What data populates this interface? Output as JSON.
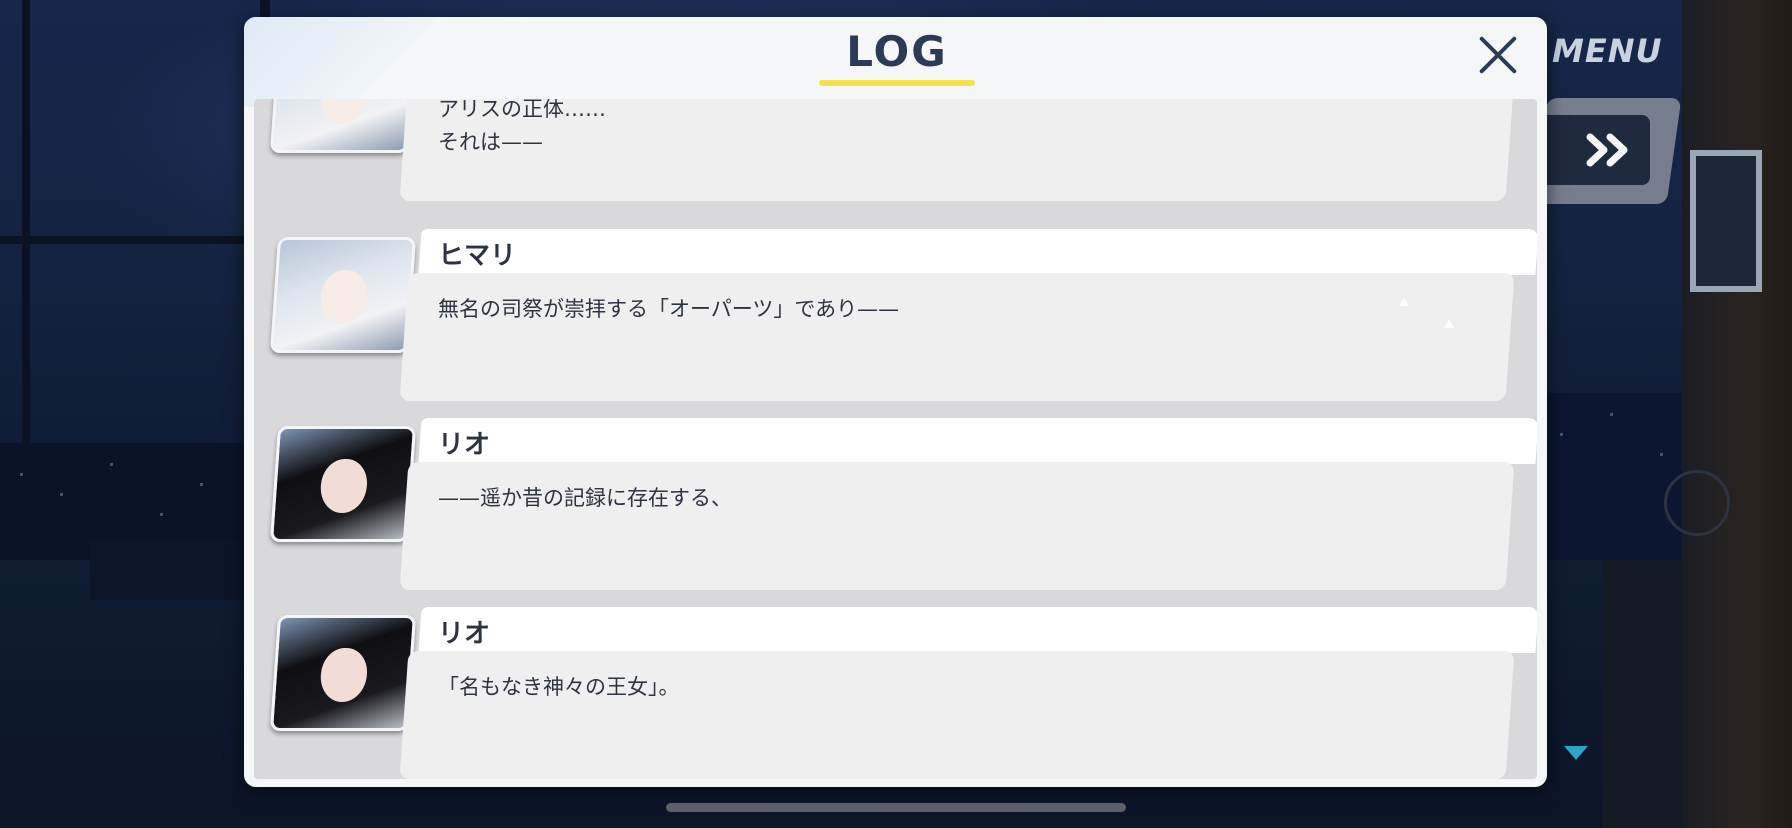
{
  "menu": {
    "label": "MENU",
    "skip_icon": "fast-forward-icon"
  },
  "log": {
    "title": "LOG",
    "close_icon": "close-icon",
    "entries": [
      {
        "speaker": "",
        "avatar": "himari",
        "text": "アリスの正体……\nそれは——"
      },
      {
        "speaker": "ヒマリ",
        "avatar": "himari",
        "text": "無名の司祭が崇拝する「オーパーツ」であり——"
      },
      {
        "speaker": "リオ",
        "avatar": "rio",
        "text": "——遥か昔の記録に存在する、"
      },
      {
        "speaker": "リオ",
        "avatar": "rio",
        "text": "「名もなき神々の王女」。"
      }
    ]
  },
  "colors": {
    "title_underline": "#f5e24a",
    "scroll_indicator": "#2aa7c8",
    "title_text": "#2b3a55"
  }
}
